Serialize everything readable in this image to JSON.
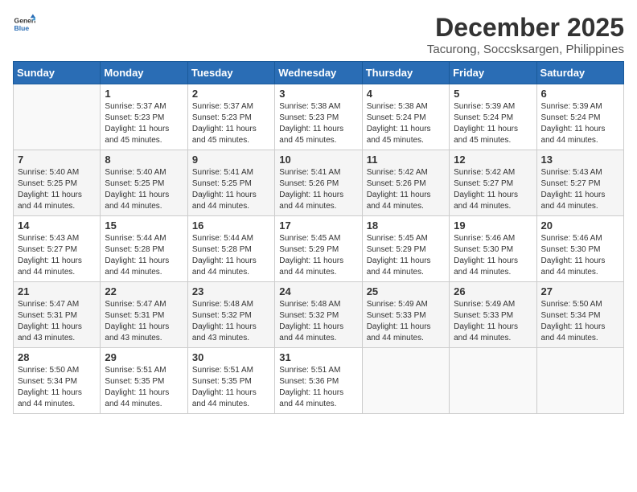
{
  "logo": {
    "line1": "General",
    "line2": "Blue"
  },
  "title": "December 2025",
  "location": "Tacurong, Soccsksargen, Philippines",
  "headers": [
    "Sunday",
    "Monday",
    "Tuesday",
    "Wednesday",
    "Thursday",
    "Friday",
    "Saturday"
  ],
  "weeks": [
    [
      {
        "day": "",
        "info": ""
      },
      {
        "day": "1",
        "info": "Sunrise: 5:37 AM\nSunset: 5:23 PM\nDaylight: 11 hours\nand 45 minutes."
      },
      {
        "day": "2",
        "info": "Sunrise: 5:37 AM\nSunset: 5:23 PM\nDaylight: 11 hours\nand 45 minutes."
      },
      {
        "day": "3",
        "info": "Sunrise: 5:38 AM\nSunset: 5:23 PM\nDaylight: 11 hours\nand 45 minutes."
      },
      {
        "day": "4",
        "info": "Sunrise: 5:38 AM\nSunset: 5:24 PM\nDaylight: 11 hours\nand 45 minutes."
      },
      {
        "day": "5",
        "info": "Sunrise: 5:39 AM\nSunset: 5:24 PM\nDaylight: 11 hours\nand 45 minutes."
      },
      {
        "day": "6",
        "info": "Sunrise: 5:39 AM\nSunset: 5:24 PM\nDaylight: 11 hours\nand 44 minutes."
      }
    ],
    [
      {
        "day": "7",
        "info": "Sunrise: 5:40 AM\nSunset: 5:25 PM\nDaylight: 11 hours\nand 44 minutes."
      },
      {
        "day": "8",
        "info": "Sunrise: 5:40 AM\nSunset: 5:25 PM\nDaylight: 11 hours\nand 44 minutes."
      },
      {
        "day": "9",
        "info": "Sunrise: 5:41 AM\nSunset: 5:25 PM\nDaylight: 11 hours\nand 44 minutes."
      },
      {
        "day": "10",
        "info": "Sunrise: 5:41 AM\nSunset: 5:26 PM\nDaylight: 11 hours\nand 44 minutes."
      },
      {
        "day": "11",
        "info": "Sunrise: 5:42 AM\nSunset: 5:26 PM\nDaylight: 11 hours\nand 44 minutes."
      },
      {
        "day": "12",
        "info": "Sunrise: 5:42 AM\nSunset: 5:27 PM\nDaylight: 11 hours\nand 44 minutes."
      },
      {
        "day": "13",
        "info": "Sunrise: 5:43 AM\nSunset: 5:27 PM\nDaylight: 11 hours\nand 44 minutes."
      }
    ],
    [
      {
        "day": "14",
        "info": "Sunrise: 5:43 AM\nSunset: 5:27 PM\nDaylight: 11 hours\nand 44 minutes."
      },
      {
        "day": "15",
        "info": "Sunrise: 5:44 AM\nSunset: 5:28 PM\nDaylight: 11 hours\nand 44 minutes."
      },
      {
        "day": "16",
        "info": "Sunrise: 5:44 AM\nSunset: 5:28 PM\nDaylight: 11 hours\nand 44 minutes."
      },
      {
        "day": "17",
        "info": "Sunrise: 5:45 AM\nSunset: 5:29 PM\nDaylight: 11 hours\nand 44 minutes."
      },
      {
        "day": "18",
        "info": "Sunrise: 5:45 AM\nSunset: 5:29 PM\nDaylight: 11 hours\nand 44 minutes."
      },
      {
        "day": "19",
        "info": "Sunrise: 5:46 AM\nSunset: 5:30 PM\nDaylight: 11 hours\nand 44 minutes."
      },
      {
        "day": "20",
        "info": "Sunrise: 5:46 AM\nSunset: 5:30 PM\nDaylight: 11 hours\nand 44 minutes."
      }
    ],
    [
      {
        "day": "21",
        "info": "Sunrise: 5:47 AM\nSunset: 5:31 PM\nDaylight: 11 hours\nand 43 minutes."
      },
      {
        "day": "22",
        "info": "Sunrise: 5:47 AM\nSunset: 5:31 PM\nDaylight: 11 hours\nand 43 minutes."
      },
      {
        "day": "23",
        "info": "Sunrise: 5:48 AM\nSunset: 5:32 PM\nDaylight: 11 hours\nand 43 minutes."
      },
      {
        "day": "24",
        "info": "Sunrise: 5:48 AM\nSunset: 5:32 PM\nDaylight: 11 hours\nand 44 minutes."
      },
      {
        "day": "25",
        "info": "Sunrise: 5:49 AM\nSunset: 5:33 PM\nDaylight: 11 hours\nand 44 minutes."
      },
      {
        "day": "26",
        "info": "Sunrise: 5:49 AM\nSunset: 5:33 PM\nDaylight: 11 hours\nand 44 minutes."
      },
      {
        "day": "27",
        "info": "Sunrise: 5:50 AM\nSunset: 5:34 PM\nDaylight: 11 hours\nand 44 minutes."
      }
    ],
    [
      {
        "day": "28",
        "info": "Sunrise: 5:50 AM\nSunset: 5:34 PM\nDaylight: 11 hours\nand 44 minutes."
      },
      {
        "day": "29",
        "info": "Sunrise: 5:51 AM\nSunset: 5:35 PM\nDaylight: 11 hours\nand 44 minutes."
      },
      {
        "day": "30",
        "info": "Sunrise: 5:51 AM\nSunset: 5:35 PM\nDaylight: 11 hours\nand 44 minutes."
      },
      {
        "day": "31",
        "info": "Sunrise: 5:51 AM\nSunset: 5:36 PM\nDaylight: 11 hours\nand 44 minutes."
      },
      {
        "day": "",
        "info": ""
      },
      {
        "day": "",
        "info": ""
      },
      {
        "day": "",
        "info": ""
      }
    ]
  ]
}
